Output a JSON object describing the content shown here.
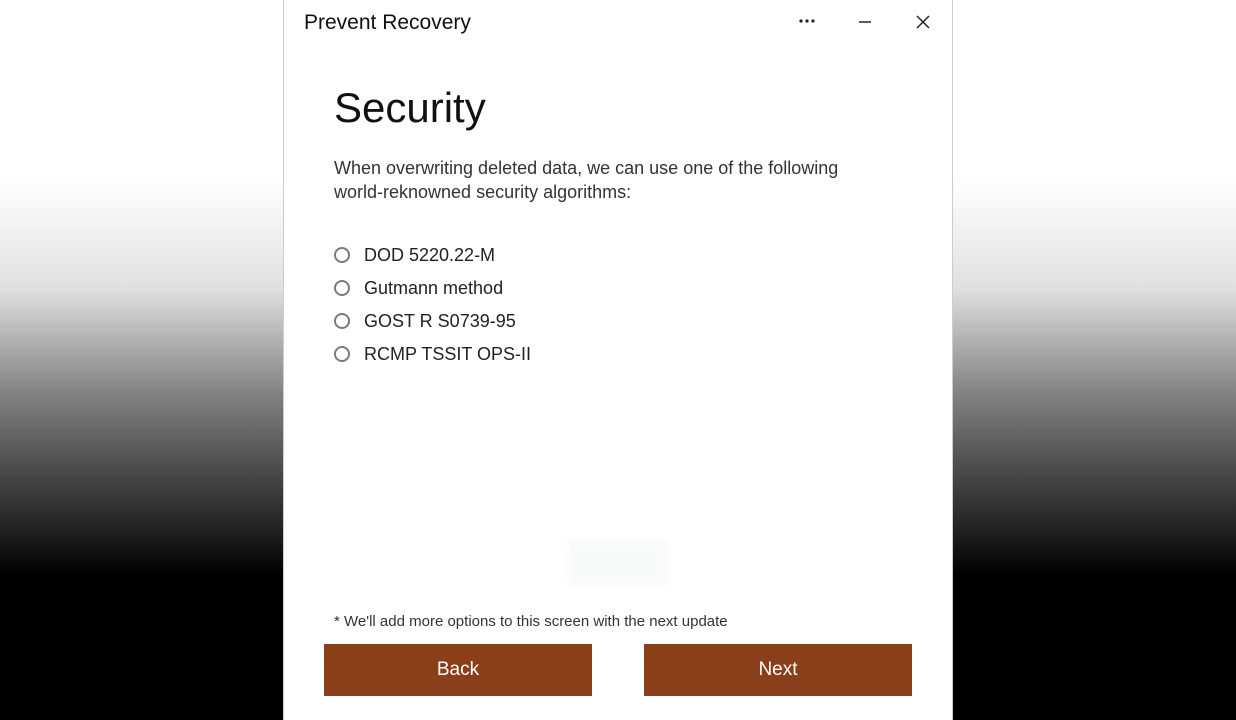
{
  "window": {
    "title": "Prevent Recovery"
  },
  "page": {
    "heading": "Security",
    "description": "When overwriting deleted data, we can use one of the following world-reknowned security algorithms:"
  },
  "options": [
    {
      "label": "DOD 5220.22-M"
    },
    {
      "label": "Gutmann method"
    },
    {
      "label": "GOST R S0739-95"
    },
    {
      "label": "RCMP TSSIT OPS-II"
    }
  ],
  "footnote": "* We'll add more options to this screen with the next update",
  "buttons": {
    "back": "Back",
    "next": "Next"
  }
}
